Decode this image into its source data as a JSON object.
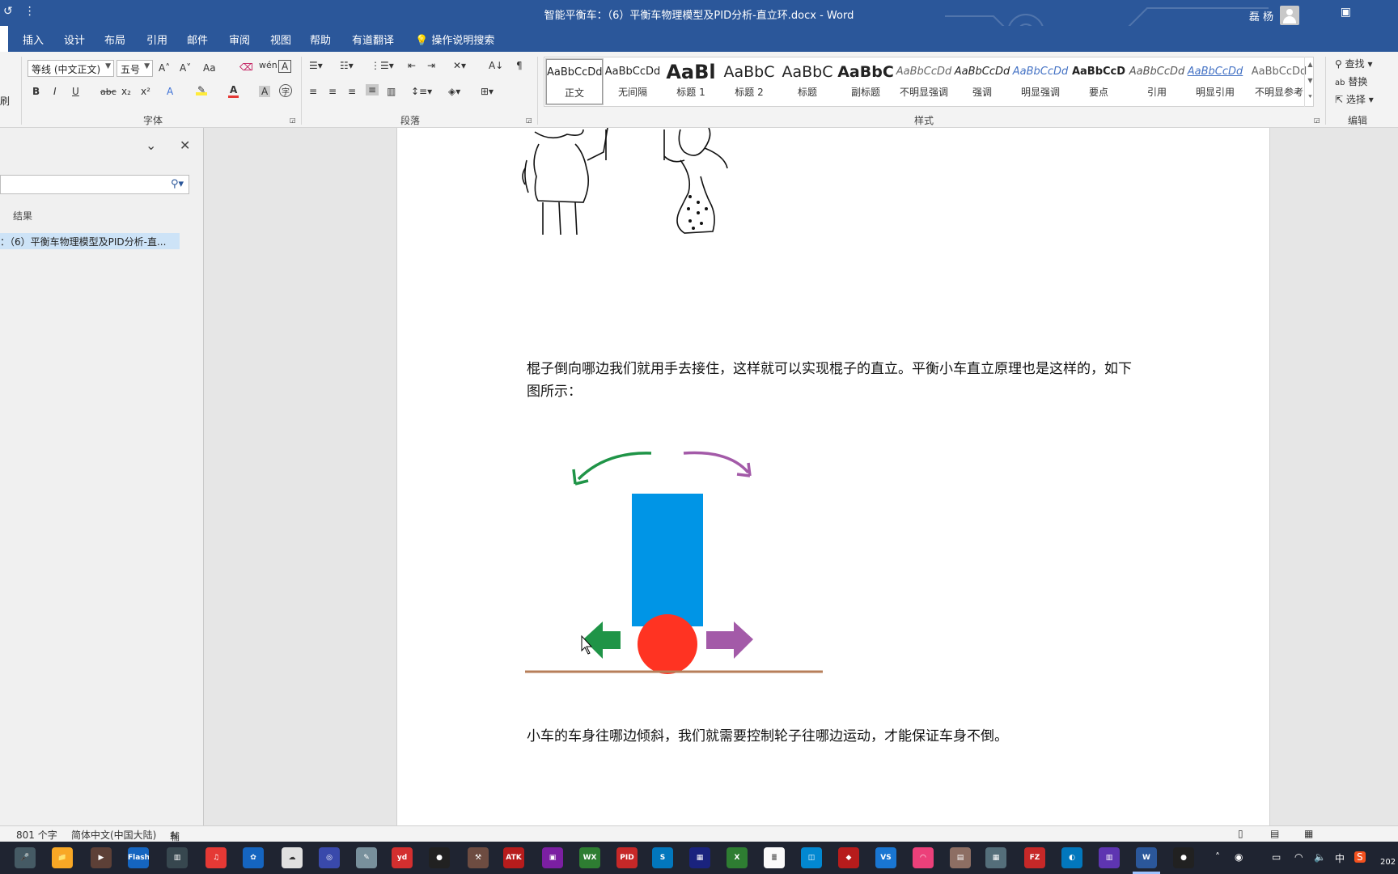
{
  "titlebar": {
    "title": "智能平衡车：（6）平衡车物理模型及PID分析-直立环.docx  -  Word",
    "user": "磊 杨",
    "qat_undo": "↺",
    "qat_more": "⋮"
  },
  "tabs": [
    "插入",
    "设计",
    "布局",
    "引用",
    "邮件",
    "审阅",
    "视图",
    "帮助",
    "有道翻译",
    "操作说明搜索"
  ],
  "ribbon": {
    "clipboard_label": "刷",
    "font_name": "等线 (中文正文)",
    "font_size": "五号",
    "font_group": "字体",
    "paragraph_group": "段落",
    "styles_group": "样式",
    "editing_group": "编辑",
    "bold": "B",
    "italic": "I",
    "underline": "U",
    "strike": "abc",
    "subscript": "x₂",
    "superscript": "x²",
    "grow": "A˄",
    "shrink": "A˅",
    "case": "Aa",
    "find": "查找",
    "replace": "替换",
    "select": "选择",
    "styles": [
      {
        "sample": "AaBbCcDd",
        "name": "正文"
      },
      {
        "sample": "AaBbCcDd",
        "name": "无间隔"
      },
      {
        "sample": "AaBl",
        "name": "标题 1"
      },
      {
        "sample": "AaBbC",
        "name": "标题 2"
      },
      {
        "sample": "AaBbC",
        "name": "标题"
      },
      {
        "sample": "AaBbC",
        "name": "副标题"
      },
      {
        "sample": "AaBbCcDd",
        "name": "不明显强调"
      },
      {
        "sample": "AaBbCcDd",
        "name": "强调"
      },
      {
        "sample": "AaBbCcDd",
        "name": "明显强调"
      },
      {
        "sample": "AaBbCcD",
        "name": "要点"
      },
      {
        "sample": "AaBbCcDd",
        "name": "引用"
      },
      {
        "sample": "AaBbCcDd",
        "name": "明显引用"
      },
      {
        "sample": "AaBbCcDd",
        "name": "不明显参考"
      }
    ]
  },
  "navpane": {
    "results_label": "结果",
    "hit_text": "：（6）平衡车物理模型及PID分析-直..."
  },
  "document": {
    "para1": "棍子倒向哪边我们就用手去接住，这样就可以实现棍子的直立。平衡小车直立原理也是这样的，如下图所示：",
    "para2": "小车的车身往哪边倾斜，我们就需要控制轮子往哪边运动，才能保证车身不倒。"
  },
  "status": {
    "word_count": "801 个字",
    "language": "简体中文(中国大陆)",
    "accessibility": "辅助功能: 调查"
  },
  "taskbar": {
    "icons": [
      {
        "name": "flash-app-icon",
        "label": "Flash",
        "color": "#1565c0"
      },
      {
        "name": "netease-music-icon",
        "label": "♫",
        "color": "#e53935"
      },
      {
        "name": "youdao-icon",
        "label": "yd",
        "color": "#d32f2f"
      },
      {
        "name": "atk-xcom-icon",
        "label": "ATK",
        "color": "#b71c1c"
      },
      {
        "name": "wechat-icon",
        "label": "WX",
        "color": "#2e7d32"
      },
      {
        "name": "atk-pid-icon",
        "label": "PID",
        "color": "#c62828"
      },
      {
        "name": "vscode-icon",
        "label": "VS",
        "color": "#1976d2"
      },
      {
        "name": "filezilla-icon",
        "label": "FZ",
        "color": "#c62828"
      },
      {
        "name": "word-taskbar-icon",
        "label": "W",
        "color": "#2b579a"
      }
    ],
    "ime": "中",
    "clock_date": "202"
  },
  "colors": {
    "word_blue": "#2b579a",
    "diagram_rect": "#0095e6",
    "diagram_wheel": "#ff3322",
    "arrow_green": "#1f9447",
    "arrow_purple": "#a35aa8",
    "ground": "#b77f5a"
  }
}
